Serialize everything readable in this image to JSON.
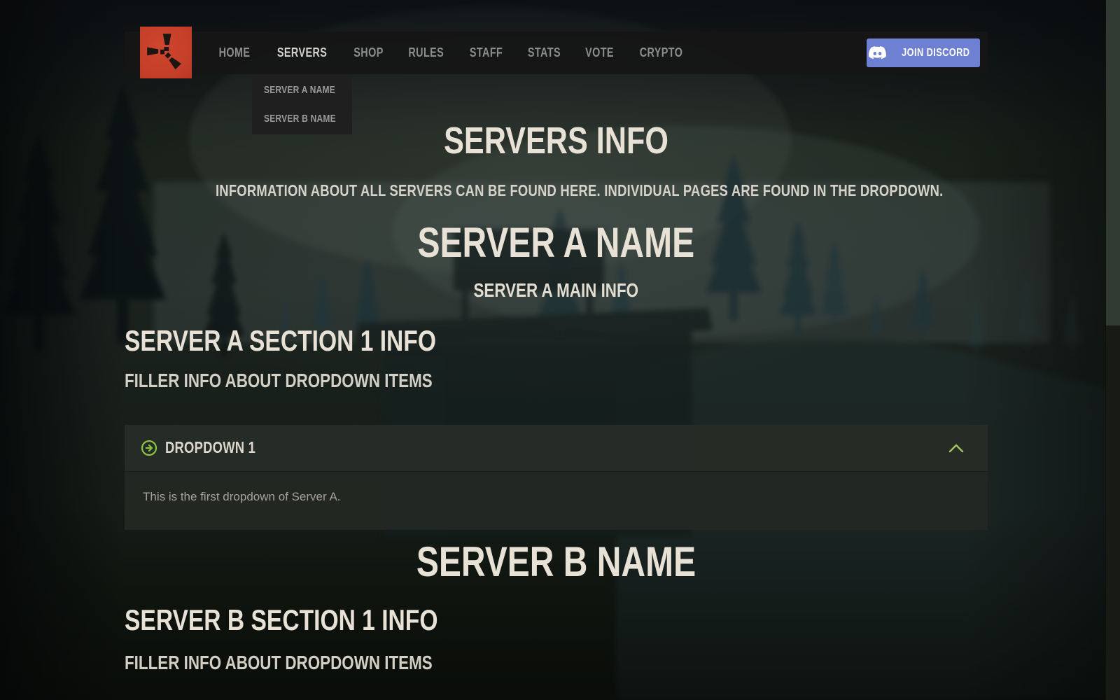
{
  "brand": {
    "logo_icon": "rust-logo",
    "logo_color": "#cd412b"
  },
  "nav": {
    "items": [
      {
        "label": "HOME",
        "active": false
      },
      {
        "label": "SERVERS",
        "active": true
      },
      {
        "label": "SHOP",
        "active": false
      },
      {
        "label": "RULES",
        "active": false
      },
      {
        "label": "STAFF",
        "active": false
      },
      {
        "label": "STATS",
        "active": false
      },
      {
        "label": "VOTE",
        "active": false
      },
      {
        "label": "CRYPTO",
        "active": false
      }
    ],
    "servers_dropdown": {
      "open": true,
      "items": [
        {
          "label": "SERVER A NAME"
        },
        {
          "label": "SERVER B NAME"
        }
      ]
    },
    "discord_button": {
      "label": "JOIN DISCORD",
      "color": "#6e80d2",
      "icon": "discord-icon"
    }
  },
  "page": {
    "title": "SERVERS INFO",
    "intro": "INFORMATION ABOUT ALL SERVERS CAN BE FOUND HERE. INDIVIDUAL PAGES ARE FOUND IN THE DROPDOWN."
  },
  "server_a": {
    "title": "SERVER A NAME",
    "main_info": "SERVER A MAIN INFO",
    "section_title": "SERVER A SECTION 1 INFO",
    "filler": "FILLER INFO ABOUT DROPDOWN ITEMS",
    "accordion": {
      "title": "DROPDOWN 1",
      "expanded": true,
      "icon": "circle-arrow-right-icon",
      "state_icon": "chevron-up-icon",
      "body": "This is the first dropdown of Server A."
    }
  },
  "server_b": {
    "title": "SERVER B NAME",
    "section_title": "SERVER B SECTION 1 INFO",
    "filler": "FILLER INFO ABOUT DROPDOWN ITEMS"
  },
  "theme": {
    "accent_green": "#8dc63f",
    "chevron_green": "#a2c862",
    "heading_color": "#e8e1d5",
    "nav_background": "#161616"
  }
}
